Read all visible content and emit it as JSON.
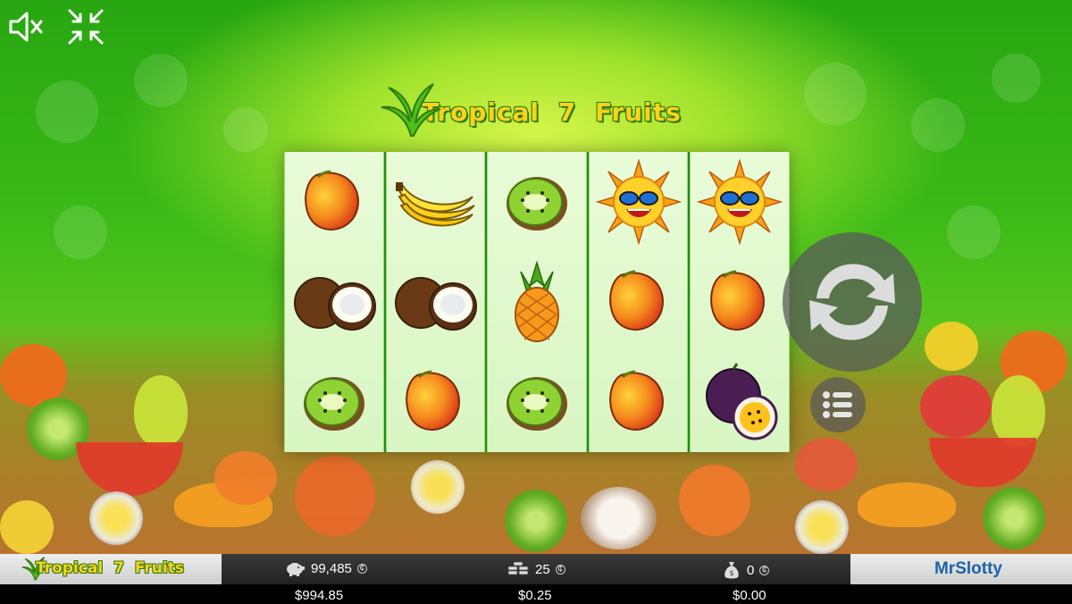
{
  "game": {
    "title_left": "Tropical",
    "title_num": "7",
    "title_right": "Fruits"
  },
  "controls": {
    "mute_icon": "speaker-muted-icon",
    "fullscreen_icon": "exit-fullscreen-icon",
    "spin_icon": "spin-arrows-icon",
    "menu_icon": "menu-list-icon"
  },
  "reels": [
    [
      "mango",
      "coconut",
      "kiwi"
    ],
    [
      "banana",
      "coconut",
      "mango"
    ],
    [
      "kiwi",
      "pineapple",
      "kiwi"
    ],
    [
      "sun",
      "mango",
      "mango"
    ],
    [
      "sun",
      "mango",
      "passion-fruit"
    ]
  ],
  "bottom_bar": {
    "logo_left": "Tropical",
    "logo_num": "7",
    "logo_right": "Fruits",
    "balance_coins": "99,485",
    "balance_money": "$994.85",
    "bet_coins": "25",
    "bet_money": "$0.25",
    "win_coins": "0",
    "win_money": "$0.00",
    "brand_prefix": "Mr",
    "brand_suffix": "Slotty"
  },
  "colors": {
    "title_yellow": "#ffd21a",
    "title_outline": "#2f7a09",
    "reel_bg": "#e9fbd8",
    "brand_blue": "#1c63a8"
  }
}
